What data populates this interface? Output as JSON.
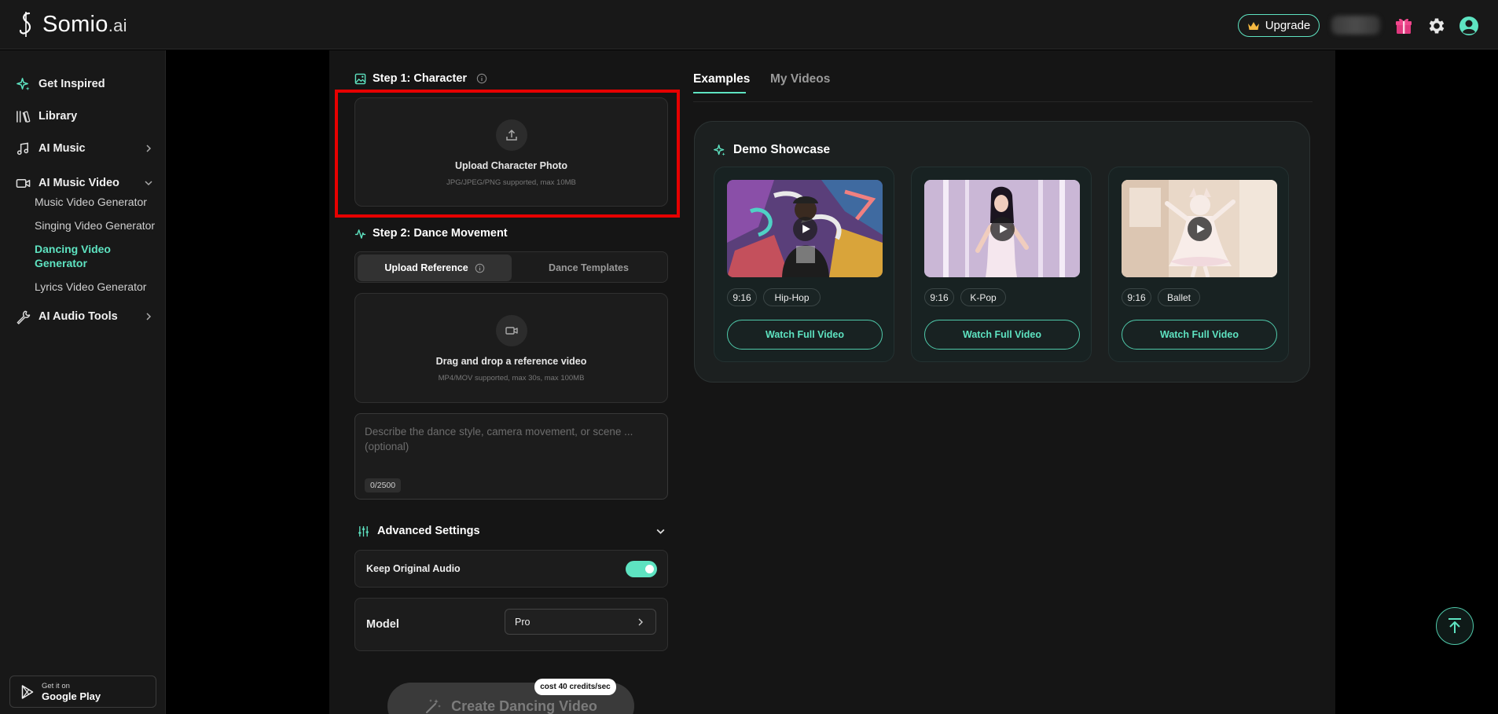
{
  "app": {
    "logo_name": "Somio",
    "logo_suffix": ".ai"
  },
  "header": {
    "upgrade_label": "Upgrade"
  },
  "sidebar": {
    "items": [
      {
        "label": "Get Inspired",
        "icon": "sparkle-icon"
      },
      {
        "label": "Library",
        "icon": "library-icon"
      },
      {
        "label": "AI Music",
        "icon": "music-note-icon"
      },
      {
        "label": "AI Music Video",
        "icon": "video-camera-icon"
      },
      {
        "label": "AI Audio Tools",
        "icon": "wrench-icon"
      }
    ],
    "sub_items": [
      {
        "label": "Music Video Generator"
      },
      {
        "label": "Singing Video Generator"
      },
      {
        "label": "Dancing Video Generator",
        "active": true
      },
      {
        "label": "Lyrics Video Generator"
      }
    ],
    "google_play": {
      "small": "Get it on",
      "big": "Google Play"
    }
  },
  "step1": {
    "title": "Step 1: Character",
    "upload_title": "Upload Character Photo",
    "upload_hint": "JPG/JPEG/PNG supported, max 10MB"
  },
  "step2": {
    "title": "Step 2: Dance Movement",
    "tabs": [
      {
        "label": "Upload Reference"
      },
      {
        "label": "Dance Templates"
      }
    ],
    "drop_title": "Drag and drop a reference video",
    "drop_hint": "MP4/MOV supported, max 30s, max 100MB",
    "prompt_placeholder": "Describe the dance style, camera movement, or scene ... (optional)",
    "char_count": "0/2500"
  },
  "advanced": {
    "title": "Advanced Settings",
    "keep_audio_label": "Keep Original Audio",
    "keep_audio_on": true,
    "model_label": "Model",
    "model_value": "Pro"
  },
  "create": {
    "label": "Create Dancing Video",
    "cost": "cost 40 credits/sec"
  },
  "right": {
    "tabs": [
      {
        "label": "Examples"
      },
      {
        "label": "My Videos"
      }
    ],
    "showcase_title": "Demo Showcase",
    "cards": [
      {
        "ratio": "9:16",
        "genre": "Hip-Hop",
        "button": "Watch Full Video"
      },
      {
        "ratio": "9:16",
        "genre": "K-Pop",
        "button": "Watch Full Video"
      },
      {
        "ratio": "9:16",
        "genre": "Ballet",
        "button": "Watch Full Video"
      }
    ]
  },
  "colors": {
    "accent": "#5ee3c1",
    "background": "#151515",
    "highlight": "#e60000"
  }
}
